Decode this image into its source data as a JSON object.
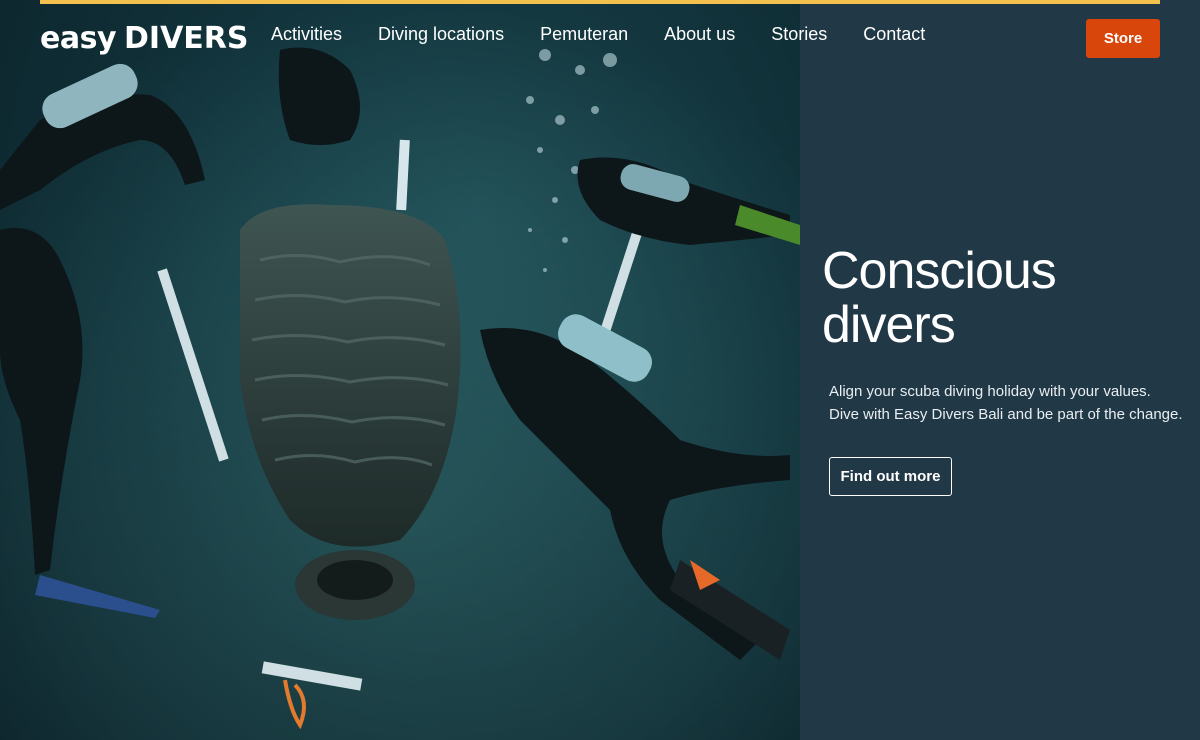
{
  "brand": {
    "logo_text_1": "easy",
    "logo_text_2": "DIVERS"
  },
  "nav": {
    "items": [
      {
        "label": "Activities"
      },
      {
        "label": "Diving locations"
      },
      {
        "label": "Pemuteran"
      },
      {
        "label": "About us"
      },
      {
        "label": "Stories"
      },
      {
        "label": "Contact"
      }
    ]
  },
  "header": {
    "store_label": "Store"
  },
  "hero": {
    "title_line_1": "Conscious",
    "title_line_2": "divers",
    "text_line_1": "Align your scuba diving holiday with your values.",
    "text_line_2": "Dive with Easy Divers Bali and be part of the change.",
    "cta_label": "Find out more",
    "image_icon": "underwater-divers-photo"
  },
  "colors": {
    "accent": "#f2c14e",
    "store_button": "#d8460b",
    "panel_bg": "#213846",
    "text": "#ffffff"
  }
}
